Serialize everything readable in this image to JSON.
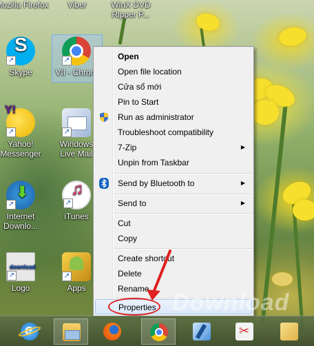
{
  "desktop": {
    "top_labels": [
      "Mozilla Firefox",
      "Viber",
      "WinX DVD Ripper P..."
    ],
    "icons": [
      {
        "label": "Skype",
        "icon": "skype-icon"
      },
      {
        "label": "VII - Chrom",
        "icon": "chrome-icon"
      },
      {
        "label": "Yahoo! Messenger",
        "icon": "yahoo-messenger-icon"
      },
      {
        "label": "Windows Live Mail",
        "icon": "windows-live-mail-icon"
      },
      {
        "label": "Internet Downlo...",
        "icon": "internet-download-manager-icon"
      },
      {
        "label": "iTunes",
        "icon": "itunes-icon"
      },
      {
        "label": "Logo",
        "icon": "logo-file-icon"
      },
      {
        "label": "Apps",
        "icon": "apps-icon"
      }
    ]
  },
  "context_menu": {
    "items": [
      {
        "label": "Open",
        "bold": true
      },
      {
        "label": "Open file location"
      },
      {
        "label": "Cửa sổ mới"
      },
      {
        "label": "Pin to Start"
      },
      {
        "label": "Run as administrator",
        "icon": "uac-shield-icon"
      },
      {
        "label": "Troubleshoot compatibility"
      },
      {
        "label": "7-Zip",
        "submenu": true
      },
      {
        "label": "Unpin from Taskbar"
      },
      {
        "label": "Send by Bluetooth to",
        "icon": "bluetooth-icon",
        "submenu": true
      },
      {
        "label": "Send to",
        "submenu": true
      },
      {
        "label": "Cut"
      },
      {
        "label": "Copy"
      },
      {
        "label": "Create shortcut"
      },
      {
        "label": "Delete"
      },
      {
        "label": "Rename"
      },
      {
        "label": "Properties",
        "highlighted": true
      }
    ]
  },
  "taskbar": {
    "buttons": [
      "internet-explorer-icon",
      "file-explorer-icon",
      "firefox-icon",
      "chrome-icon",
      "windows-live-writer-icon",
      "snipping-tool-icon",
      "folder-icon"
    ]
  },
  "watermark": "Download",
  "colors": {
    "highlight_circle": "#e02020",
    "arrow": "#e02020"
  }
}
